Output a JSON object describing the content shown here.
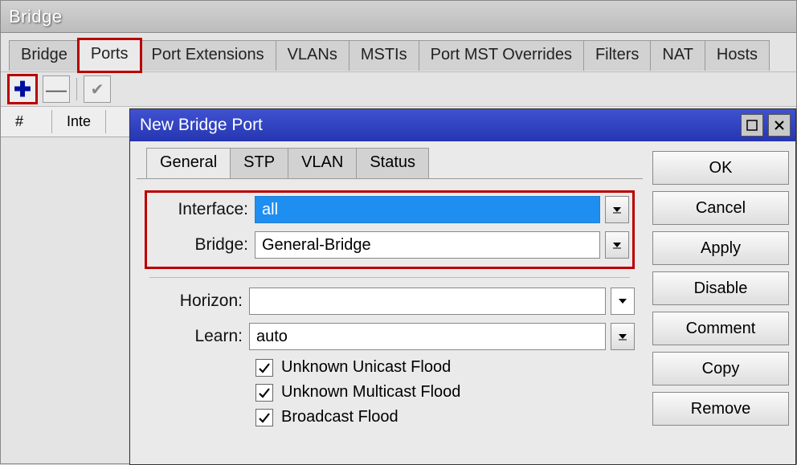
{
  "bridge_window": {
    "title": "Bridge",
    "tabs": [
      {
        "label": "Bridge"
      },
      {
        "label": "Ports"
      },
      {
        "label": "Port Extensions"
      },
      {
        "label": "VLANs"
      },
      {
        "label": "MSTIs"
      },
      {
        "label": "Port MST Overrides"
      },
      {
        "label": "Filters"
      },
      {
        "label": "NAT"
      },
      {
        "label": "Hosts"
      }
    ],
    "list_header": {
      "col_index": "#",
      "col_interface": "Inte"
    }
  },
  "modal": {
    "title": "New Bridge Port",
    "tabs": [
      {
        "label": "General"
      },
      {
        "label": "STP"
      },
      {
        "label": "VLAN"
      },
      {
        "label": "Status"
      }
    ],
    "form": {
      "interface": {
        "label": "Interface:",
        "value": "all"
      },
      "bridge": {
        "label": "Bridge:",
        "value": "General-Bridge"
      },
      "horizon": {
        "label": "Horizon:",
        "value": ""
      },
      "learn": {
        "label": "Learn:",
        "value": "auto"
      },
      "unknown_unicast": {
        "label": "Unknown Unicast Flood",
        "checked": true
      },
      "unknown_multicast": {
        "label": "Unknown Multicast Flood",
        "checked": true
      },
      "broadcast": {
        "label": "Broadcast Flood",
        "checked": true
      }
    },
    "buttons": {
      "ok": "OK",
      "cancel": "Cancel",
      "apply": "Apply",
      "disable": "Disable",
      "comment": "Comment",
      "copy": "Copy",
      "remove": "Remove"
    }
  }
}
